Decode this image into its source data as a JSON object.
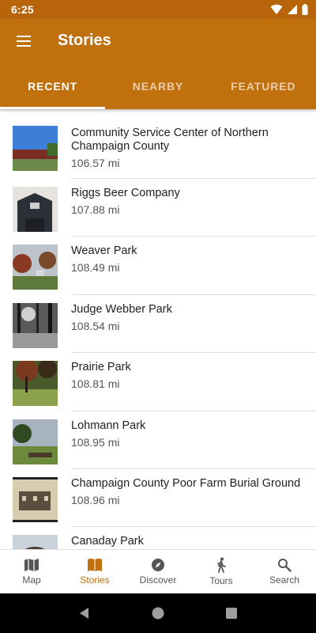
{
  "status_bar": {
    "time": "6:25"
  },
  "app_bar": {
    "title": "Stories",
    "menu_icon": "menu-icon"
  },
  "tabs": [
    {
      "label": "RECENT",
      "active": true
    },
    {
      "label": "NEARBY",
      "active": false
    },
    {
      "label": "FEATURED",
      "active": false
    }
  ],
  "stories": [
    {
      "title": "Community Service Center of Northern Champaign County",
      "distance": "106.57 mi"
    },
    {
      "title": "Riggs Beer Company",
      "distance": "107.88 mi"
    },
    {
      "title": "Weaver Park",
      "distance": "108.49 mi"
    },
    {
      "title": "Judge Webber Park",
      "distance": "108.54 mi"
    },
    {
      "title": "Prairie Park",
      "distance": "108.81 mi"
    },
    {
      "title": "Lohmann Park",
      "distance": "108.95 mi"
    },
    {
      "title": "Champaign County Poor Farm Burial Ground",
      "distance": "108.96 mi"
    },
    {
      "title": "Canaday Park",
      "distance": ""
    }
  ],
  "bottom_nav": {
    "map": {
      "label": "Map",
      "icon": "map-icon"
    },
    "stories": {
      "label": "Stories",
      "icon": "book-icon"
    },
    "discover": {
      "label": "Discover",
      "icon": "compass-icon"
    },
    "tours": {
      "label": "Tours",
      "icon": "walking-icon"
    },
    "search": {
      "label": "Search",
      "icon": "search-icon"
    }
  },
  "colors": {
    "primary": "#c1700e",
    "status_bar": "#b8640a",
    "active_nav": "#c1700e"
  }
}
